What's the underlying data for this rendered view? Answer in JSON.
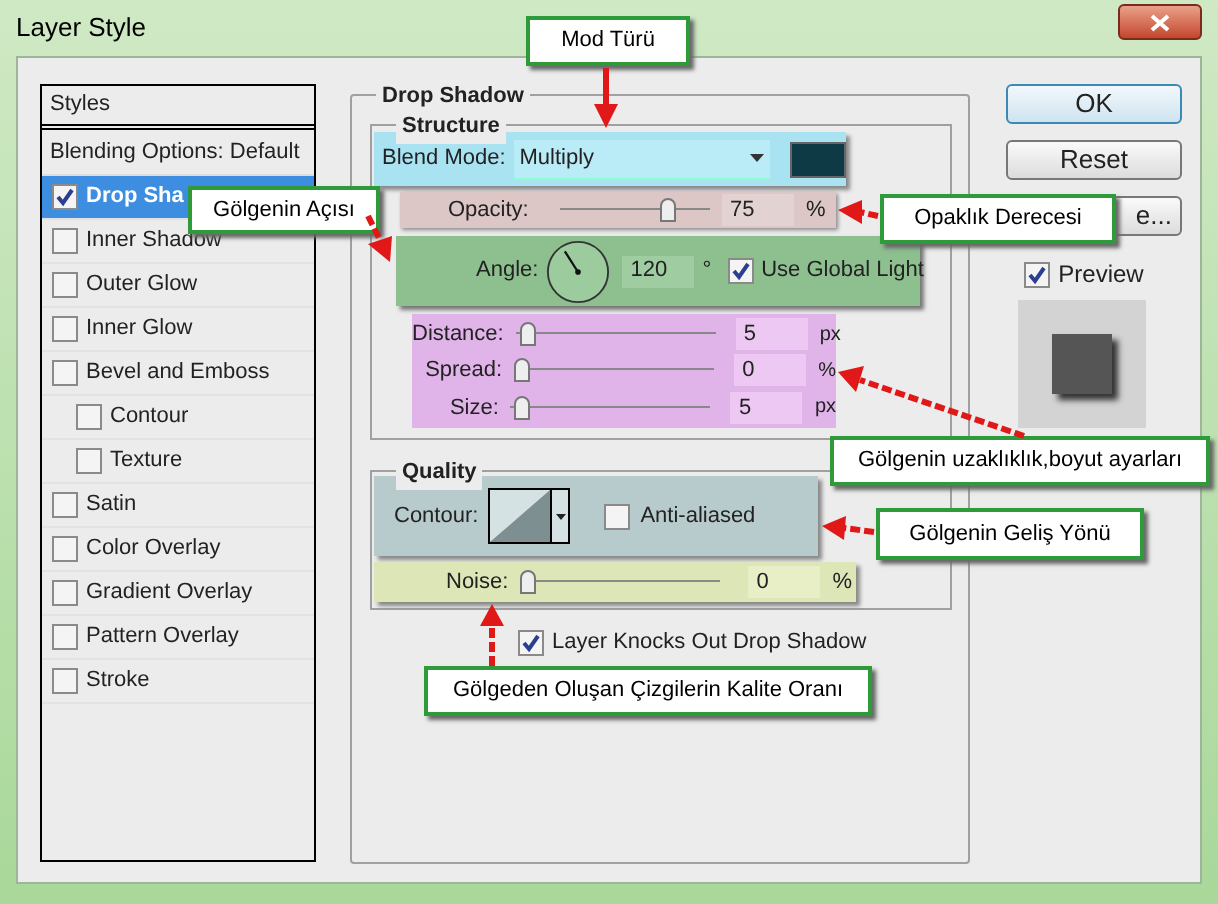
{
  "window": {
    "title": "Layer Style"
  },
  "styles_list": {
    "header": "Styles",
    "blending_options": "Blending Options: Default",
    "items": [
      {
        "label": "Drop Sha",
        "checked": true,
        "selected": true
      },
      {
        "label": "Inner Shadow",
        "checked": false,
        "selected": false
      },
      {
        "label": "Outer Glow",
        "checked": false,
        "selected": false
      },
      {
        "label": "Inner Glow",
        "checked": false,
        "selected": false
      },
      {
        "label": "Bevel and Emboss",
        "checked": false,
        "selected": false,
        "children": [
          {
            "label": "Contour",
            "checked": false,
            "selected": false
          },
          {
            "label": "Texture",
            "checked": false,
            "selected": false
          }
        ]
      },
      {
        "label": "Satin",
        "checked": false,
        "selected": false
      },
      {
        "label": "Color Overlay",
        "checked": false,
        "selected": false
      },
      {
        "label": "Gradient Overlay",
        "checked": false,
        "selected": false
      },
      {
        "label": "Pattern Overlay",
        "checked": false,
        "selected": false
      },
      {
        "label": "Stroke",
        "checked": false,
        "selected": false
      }
    ]
  },
  "drop_shadow": {
    "title": "Drop Shadow",
    "structure": {
      "title": "Structure",
      "blend_mode": {
        "label": "Blend Mode:",
        "value": "Multiply"
      },
      "opacity": {
        "label": "Opacity:",
        "level": 0.75,
        "value": "75",
        "unit": "%"
      },
      "angle": {
        "label": "Angle:",
        "value": "120",
        "unit": "°",
        "use_global_light": {
          "label": "Use Global Light",
          "checked": true
        }
      },
      "sliders": [
        {
          "label": "Distance:",
          "level": 0.02,
          "value": "5",
          "unit": "px"
        },
        {
          "label": "Spread:",
          "level": 0,
          "value": "0",
          "unit": "%"
        },
        {
          "label": "Size:",
          "level": 0.02,
          "value": "5",
          "unit": "px"
        }
      ]
    },
    "quality": {
      "title": "Quality",
      "contour": {
        "label": "Contour:"
      },
      "anti_aliased": {
        "label": "Anti-aliased",
        "checked": false
      },
      "noise": {
        "label": "Noise:",
        "level": 0,
        "value": "0",
        "unit": "%"
      }
    },
    "layer_knocks_out": {
      "label": "Layer Knocks Out Drop Shadow",
      "checked": true
    }
  },
  "buttons": [
    "OK",
    "Reset",
    "e..."
  ],
  "preview": {
    "label": "Preview",
    "checked": true
  },
  "annotations": [
    {
      "text": "Mod Türü"
    },
    {
      "text": "Gölgenin Açısı"
    },
    {
      "text": "Opaklık Derecesi"
    },
    {
      "text": "Gölgenin uzaklıklık,boyut ayarları"
    },
    {
      "text": "Gölgenin Geliş Yönü"
    },
    {
      "text": "Gölgeden Oluşan Çizgilerin Kalite Oranı"
    }
  ]
}
